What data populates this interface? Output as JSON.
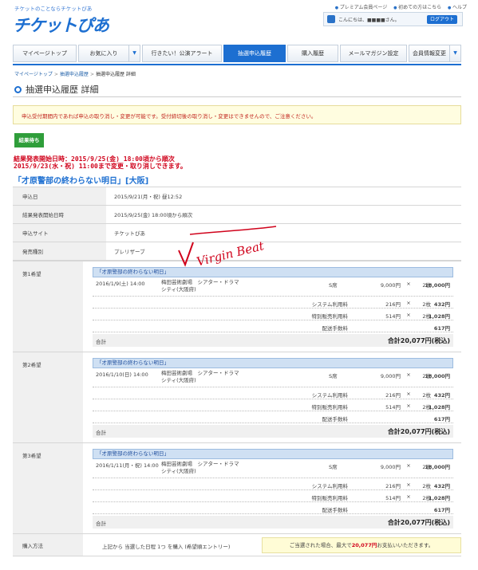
{
  "header": {
    "tagline": "チケットのことならチケットぴあ",
    "logo": "チケットぴあ",
    "links": [
      "プレミアム会員ページ",
      "初めての方はこちら",
      "ヘルプ"
    ],
    "greeting": "こんにちは、■■■■さん。",
    "logout_label": "ログアウト"
  },
  "nav": {
    "tabs": [
      {
        "label": "マイページトップ",
        "dropdown": false,
        "active": false
      },
      {
        "label": "お気に入り",
        "dropdown": true,
        "active": false
      },
      {
        "label": "行きたい！公演アラート",
        "dropdown": false,
        "active": false
      },
      {
        "label": "抽選申込履歴",
        "dropdown": false,
        "active": true
      },
      {
        "label": "購入履歴",
        "dropdown": false,
        "active": false
      },
      {
        "label": "メールマガジン設定",
        "dropdown": false,
        "active": false
      },
      {
        "label": "会員情報変更",
        "dropdown": true,
        "active": false
      }
    ]
  },
  "breadcrumb": {
    "items": [
      "マイページトップ",
      "抽選申込履歴",
      "抽選申込履歴 詳細"
    ]
  },
  "page_title": "抽選申込履歴 詳細",
  "notice": "申込受付期間内であれば申込の取り消し・変更が可能です。受付締切後の取り消し・変更はできませんので、ご注意ください。",
  "status_label": "結果待ち",
  "red_message": {
    "line1": "結果発表開始日時：2015/9/25(金) 18:00頃から順次",
    "line2": "2015/9/23(水・祝) 11:00まで変更・取り消しできます。"
  },
  "event_title": "「才原警部の終わらない明日」[大阪]",
  "info": [
    {
      "key": "申込日",
      "value": "2015/9/21(月・祝) 昼12:52"
    },
    {
      "key": "結果発表開始日時",
      "value": "2015/9/25(金) 18:00頃から順次"
    },
    {
      "key": "申込サイト",
      "value": "チケットぴあ"
    },
    {
      "key": "発売種別",
      "value": "プレリザーブ"
    }
  ],
  "signature_text": "Virgin Beat",
  "choices": [
    {
      "label": "第1希望",
      "event": "「才原警部の終わらない明日」",
      "date": "2016/1/9(土) 14:00",
      "venue": "梅田芸術劇場　シアター・ドラマシティ(大阪府)",
      "seat": "S席",
      "unit": "9,000円",
      "qty": "2枚",
      "amount": "18,000円",
      "fees": [
        {
          "name": "システム利用料",
          "unit": "216円",
          "qty": "2枚",
          "amount": "432円"
        },
        {
          "name": "特別販売利用料",
          "unit": "514円",
          "qty": "2枚",
          "amount": "1,028円"
        },
        {
          "name": "配送手数料",
          "unit": "",
          "qty": "",
          "amount": "617円"
        }
      ],
      "total_label": "合計",
      "total": "合計20,077円(税込)"
    },
    {
      "label": "第2希望",
      "event": "「才原警部の終わらない明日」",
      "date": "2016/1/10(日) 14:00",
      "venue": "梅田芸術劇場　シアター・ドラマシティ(大阪府)",
      "seat": "S席",
      "unit": "9,000円",
      "qty": "2枚",
      "amount": "18,000円",
      "fees": [
        {
          "name": "システム利用料",
          "unit": "216円",
          "qty": "2枚",
          "amount": "432円"
        },
        {
          "name": "特別販売利用料",
          "unit": "514円",
          "qty": "2枚",
          "amount": "1,028円"
        },
        {
          "name": "配送手数料",
          "unit": "",
          "qty": "",
          "amount": "617円"
        }
      ],
      "total_label": "合計",
      "total": "合計20,077円(税込)"
    },
    {
      "label": "第3希望",
      "event": "「才原警部の終わらない明日」",
      "date": "2016/1/11(月・祝) 14:00",
      "venue": "梅田芸術劇場　シアター・ドラマシティ(大阪府)",
      "seat": "S席",
      "unit": "9,000円",
      "qty": "2枚",
      "amount": "18,000円",
      "fees": [
        {
          "name": "システム利用料",
          "unit": "216円",
          "qty": "2枚",
          "amount": "432円"
        },
        {
          "name": "特別販売利用料",
          "unit": "514円",
          "qty": "2枚",
          "amount": "1,028円"
        },
        {
          "name": "配送手数料",
          "unit": "",
          "qty": "",
          "amount": "617円"
        }
      ],
      "total_label": "合計",
      "total": "合計20,077円(税込)"
    }
  ],
  "purchase": {
    "label": "購入方法",
    "desc": "上記から 当選した日程 1つ を購入 (希望順エントリー)",
    "note_prefix": "ご当選された場合、最大で",
    "note_amount": "20,077円",
    "note_suffix": "お支払いいただきます。"
  },
  "colors": {
    "accent": "#1d6fd1",
    "alert": "#d0021b",
    "status": "#2f9e3a"
  }
}
